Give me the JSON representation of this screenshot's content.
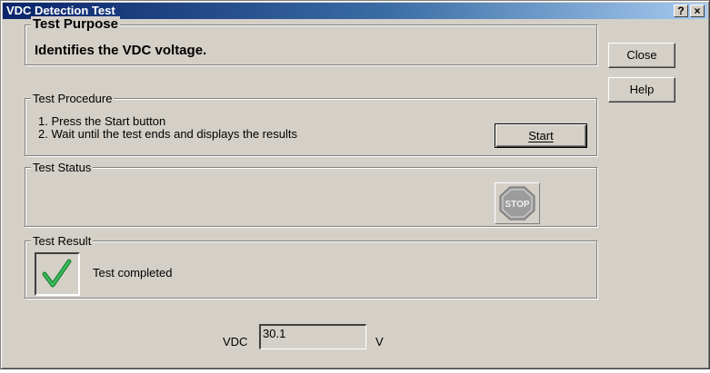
{
  "window": {
    "title": "VDC Detection Test",
    "help_glyph": "?",
    "close_glyph": "×"
  },
  "purpose": {
    "legend": "Test Purpose",
    "text": "Identifies the VDC voltage."
  },
  "procedure": {
    "legend": "Test Procedure",
    "steps": [
      "1. Press the Start button",
      "2. Wait until the test ends and displays the results"
    ],
    "start_label": "Start"
  },
  "status": {
    "legend": "Test Status",
    "stop_icon_text": "STOP"
  },
  "result": {
    "legend": "Test Result",
    "text": "Test completed",
    "icon": "checkmark-icon"
  },
  "buttons": {
    "close_label": "Close",
    "help_label": "Help"
  },
  "vdc": {
    "label": "VDC",
    "value": "30.1",
    "unit": "V"
  },
  "colors": {
    "title_start": "#0a246a",
    "title_end": "#a6caf0",
    "face": "#d4d0c8",
    "check_green": "#1f8a3a",
    "stop_gray": "#9c9c9c"
  }
}
